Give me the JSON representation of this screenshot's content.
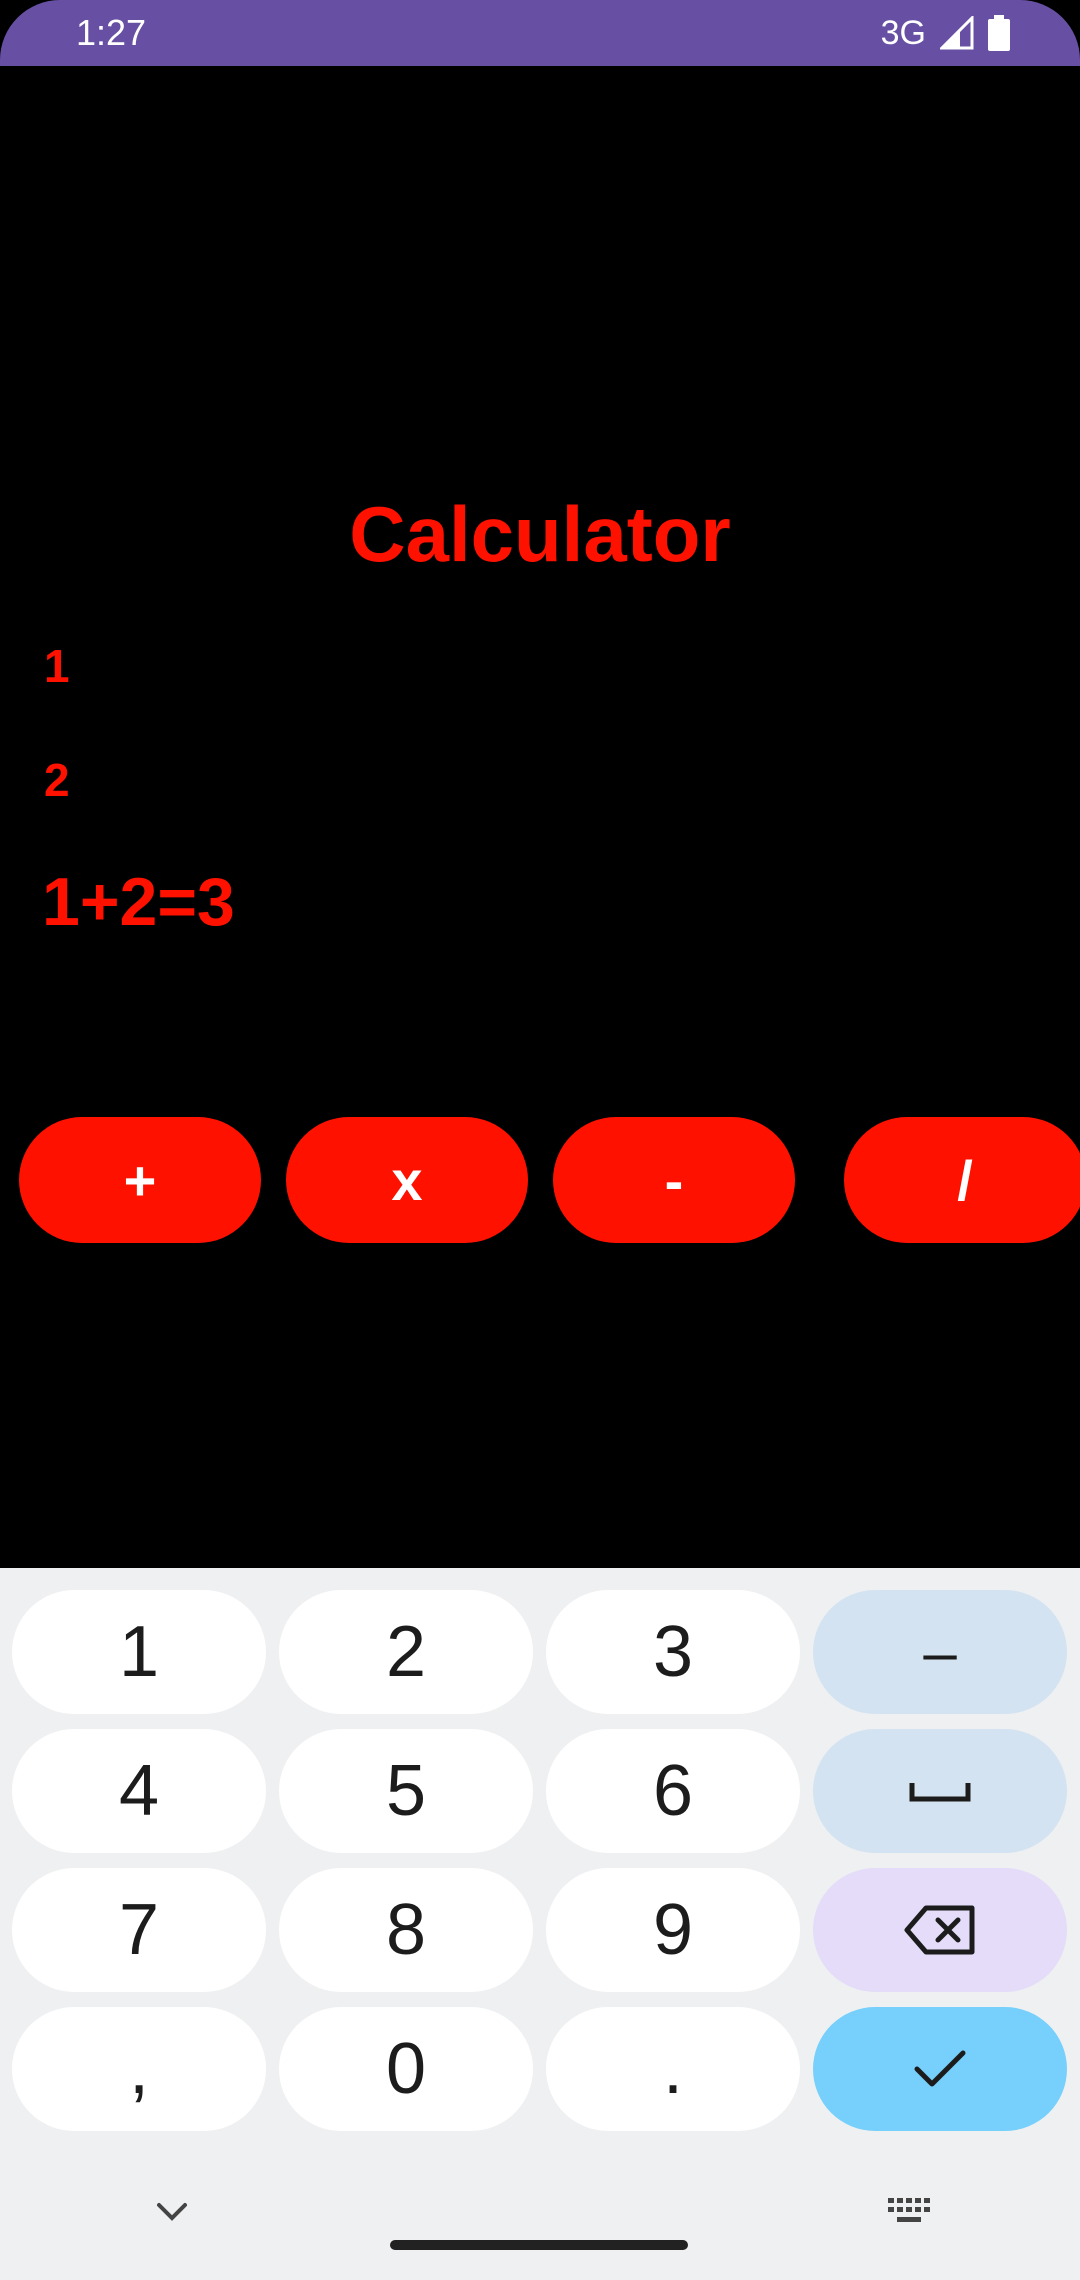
{
  "status_bar": {
    "time": "1:27",
    "network": "3G"
  },
  "app": {
    "title": "Calculator",
    "input_1": "1",
    "input_2": "2",
    "result": "1+2=3",
    "buttons": {
      "add": "+",
      "multiply": "x",
      "subtract": "-",
      "divide": "/"
    }
  },
  "keyboard": {
    "keys": {
      "k1": "1",
      "k2": "2",
      "k3": "3",
      "dash": "–",
      "k4": "4",
      "k5": "5",
      "k6": "6",
      "k7": "7",
      "k8": "8",
      "k9": "9",
      "comma": ",",
      "k0": "0",
      "period": "."
    },
    "icons": {
      "space": "space-bar-icon",
      "backspace": "backspace-icon",
      "done": "check-icon",
      "hide": "chevron-down-icon",
      "switch": "keyboard-icon"
    }
  }
}
